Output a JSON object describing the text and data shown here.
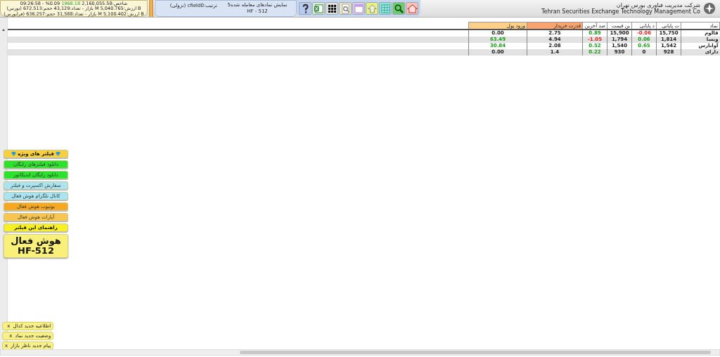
{
  "market_summary": {
    "index": {
      "before": "09:26:58 - %0.09",
      "change": "1968.18",
      "after": "2,160,055.58:شاخص"
    },
    "markets": [
      "(بورس) بازار - تعداد:43,129 حجم:672.513 M ارزش:5,040.765 B",
      "(فرابورس) بازار - تعداد:31,588 حجم:636.257 M ارزش:5,100.402 B"
    ]
  },
  "filter_info": {
    "title": "5نمایش نمادهای معامله شده",
    "code": "HF - 512"
  },
  "sort": "ترتیب:cfield0 (نزولی)",
  "company": {
    "name_fa": "شرکت مدیریت فناوری بورس تهران",
    "name_en": "Tehran Securities Exchange Technology Management Co"
  },
  "table": {
    "columns": [
      {
        "label": "نماد",
        "color": "#ffffff"
      },
      {
        "label": "ت پایانی",
        "color": "#ffffff"
      },
      {
        "label": "د پایانی",
        "color": "#ffffff"
      },
      {
        "label": "ین قیمت",
        "color": "#ffffff"
      },
      {
        "label": "صد آخرین",
        "color": "#ffffff"
      },
      {
        "label": "قدرت خریدار",
        "color": "#f9a46e"
      },
      {
        "label": "ورود پول",
        "color": "#fcd089"
      }
    ],
    "rows": [
      {
        "cells": [
          {
            "text": "فالوم",
            "color": "#222222"
          },
          {
            "text": "15,750",
            "color": "#222222"
          },
          {
            "text": "-0.06",
            "color": "#e02020"
          },
          {
            "text": "15,900",
            "color": "#222222"
          },
          {
            "text": "0.89",
            "color": "#1c9b1c"
          },
          {
            "text": "2.75",
            "color": "#222222"
          },
          {
            "text": "0.00",
            "color": "#222222"
          }
        ]
      },
      {
        "cells": [
          {
            "text": "وبسا",
            "color": "#222222"
          },
          {
            "text": "1,814",
            "color": "#222222"
          },
          {
            "text": "0.06",
            "color": "#1c9b1c"
          },
          {
            "text": "1,794",
            "color": "#222222"
          },
          {
            "text": "-1.05",
            "color": "#e02020"
          },
          {
            "text": "4.94",
            "color": "#222222"
          },
          {
            "text": "63.49",
            "color": "#1c9b1c"
          }
        ]
      },
      {
        "cells": [
          {
            "text": "آوابارس",
            "color": "#222222"
          },
          {
            "text": "1,542",
            "color": "#222222"
          },
          {
            "text": "0.65",
            "color": "#1c9b1c"
          },
          {
            "text": "1,540",
            "color": "#222222"
          },
          {
            "text": "0.52",
            "color": "#1c9b1c"
          },
          {
            "text": "2.08",
            "color": "#222222"
          },
          {
            "text": "30.84",
            "color": "#1c9b1c"
          }
        ]
      },
      {
        "cells": [
          {
            "text": "دارای",
            "color": "#222222"
          },
          {
            "text": "928",
            "color": "#222222"
          },
          {
            "text": "0",
            "color": "#222222"
          },
          {
            "text": "930",
            "color": "#222222"
          },
          {
            "text": "0.22",
            "color": "#1c9b1c"
          },
          {
            "text": "1.4",
            "color": "#222222"
          },
          {
            "text": "0.00",
            "color": "#222222"
          }
        ]
      }
    ]
  },
  "side_menu": [
    {
      "kind": "header",
      "label": "فیلتر های ویژه",
      "color": "#f8cf3c"
    },
    {
      "kind": "link",
      "label": "دانلود فیلترهای رایگان",
      "color": "#2de22d"
    },
    {
      "kind": "link",
      "label": "دانلود رایگان اندیکاتور",
      "color": "#2de22d"
    },
    {
      "kind": "link",
      "label": "سفارش اکسپرت و فیلتر",
      "color": "#a9e4f0"
    },
    {
      "kind": "link",
      "label": "کانال تلگرام هوش فعال",
      "color": "#a9e4f0"
    },
    {
      "kind": "link",
      "label": "یوتیوب هوش فعال",
      "color": "#f7a81e"
    },
    {
      "kind": "link",
      "label": "آپارات هوش فعال",
      "color": "#f8c550"
    },
    {
      "kind": "header",
      "label": "راهنمای این فیلتر",
      "color": "#f8f020"
    },
    {
      "kind": "brand",
      "label": "هوش فعال",
      "code": "HF-512",
      "color": "#f8f078"
    }
  ],
  "notifications": [
    {
      "label": "اطلاعیه جدید کدال",
      "close": "x"
    },
    {
      "label": "وضعیت جدید نماد",
      "close": "x"
    },
    {
      "label": "پیام جدید ناظر بازار",
      "close": "x"
    }
  ]
}
